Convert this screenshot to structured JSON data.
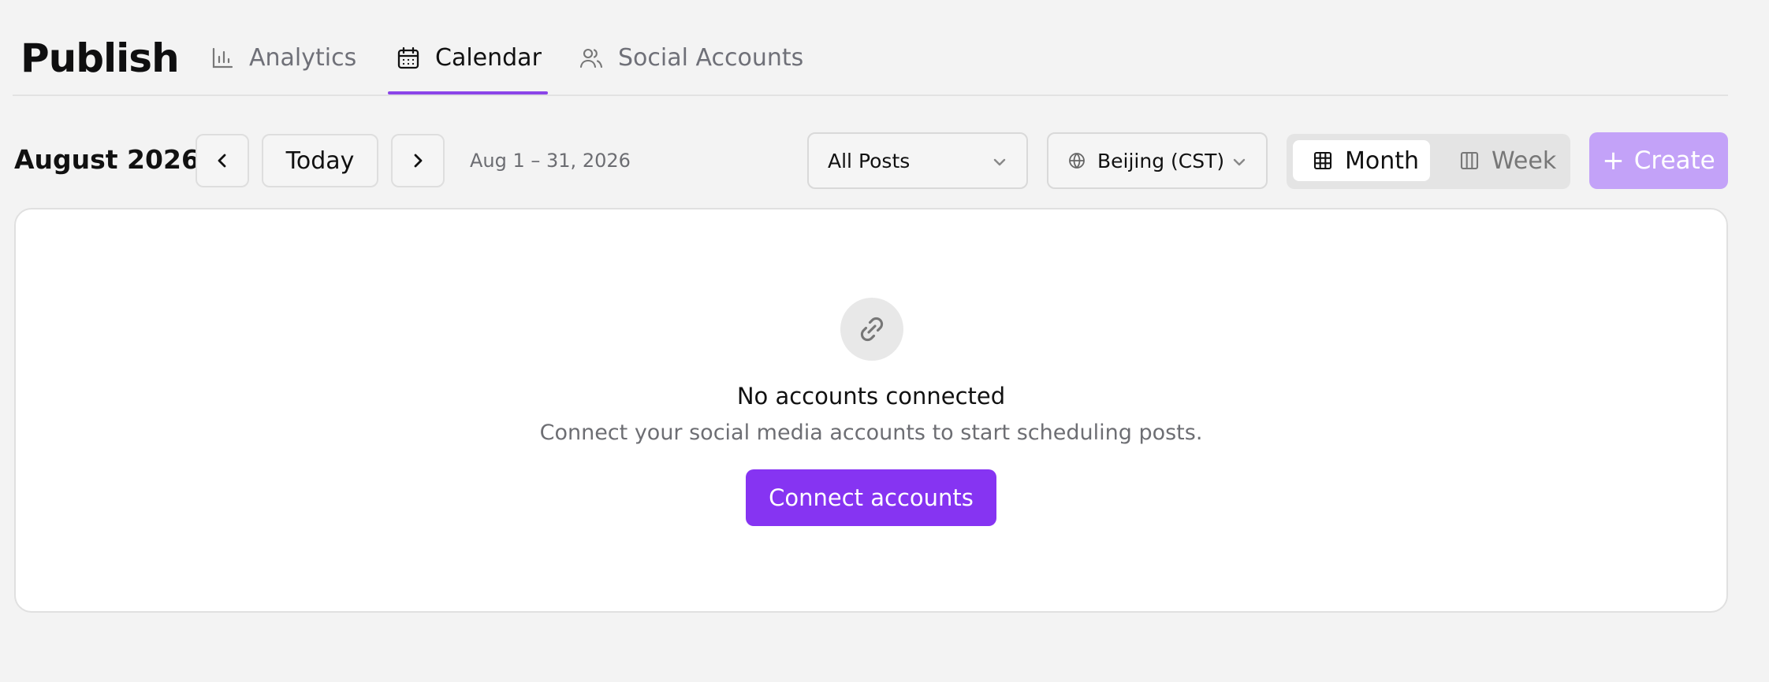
{
  "header": {
    "title": "Publish",
    "tabs": [
      {
        "label": "Analytics",
        "icon": "bar-chart-icon",
        "active": false
      },
      {
        "label": "Calendar",
        "icon": "calendar-icon",
        "active": true
      },
      {
        "label": "Social Accounts",
        "icon": "users-icon",
        "active": false
      }
    ]
  },
  "toolbar": {
    "month": "August 2026",
    "today": "Today",
    "range": "Aug 1 – 31, 2026",
    "filter": "All Posts",
    "timezone": "Beijing (CST)",
    "views": {
      "month": "Month",
      "week": "Week",
      "selected": "Month"
    },
    "create": "Create"
  },
  "empty_state": {
    "title": "No accounts connected",
    "description": "Connect your social media accounts to start scheduling posts.",
    "button": "Connect accounts"
  },
  "colors": {
    "accent": "#8634f2",
    "create_disabled": "#c3a2f8",
    "tab_underline": "#8b45e8"
  }
}
